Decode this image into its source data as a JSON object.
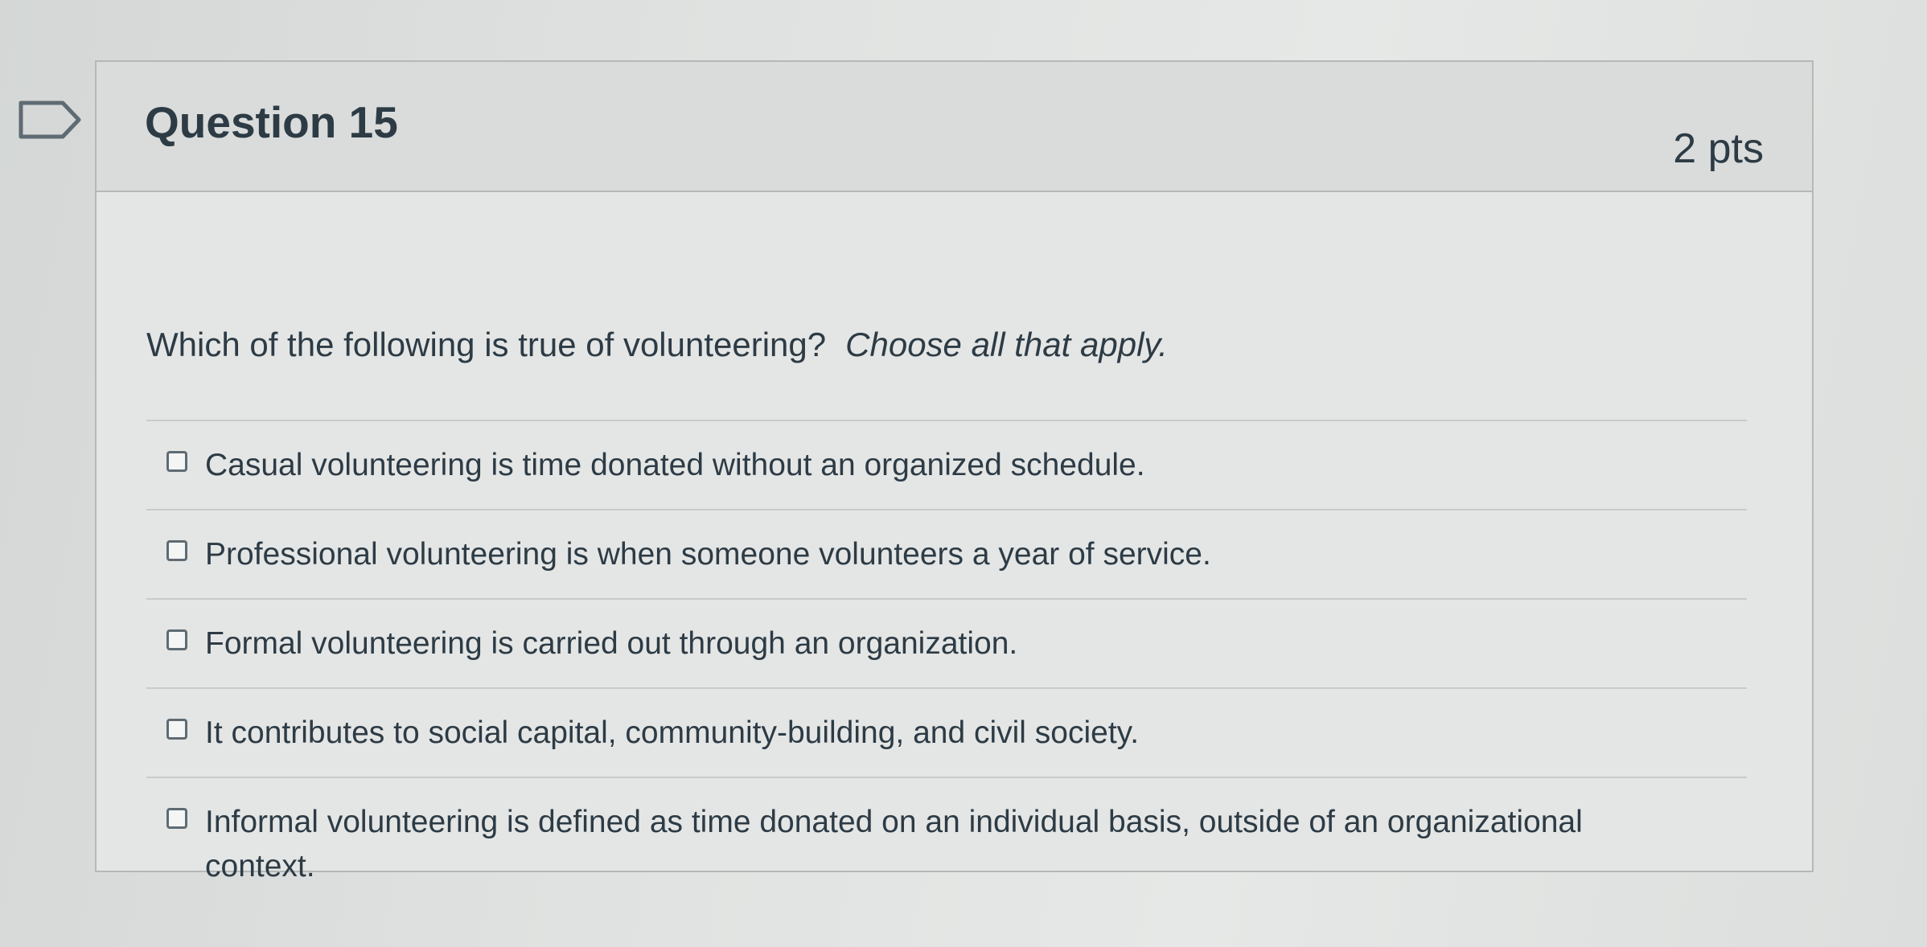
{
  "question": {
    "title": "Question 15",
    "points": "2 pts",
    "prompt": "Which of the following is true of volunteering?",
    "instruction": "Choose all that apply.",
    "answers": [
      "Casual volunteering is time donated without an organized schedule.",
      "Professional volunteering is when someone volunteers a year of service.",
      "Formal volunteering is carried out through an organization.",
      "It contributes to social capital, community-building, and civil society.",
      "Informal volunteering is defined as time donated on an individual basis, outside of an organizational context."
    ]
  },
  "icons": {
    "flag": "bookmark-flag-icon"
  },
  "colors": {
    "text": "#2d3b45",
    "border": "#b4b9b8",
    "header_bg": "#d9dcdb"
  }
}
